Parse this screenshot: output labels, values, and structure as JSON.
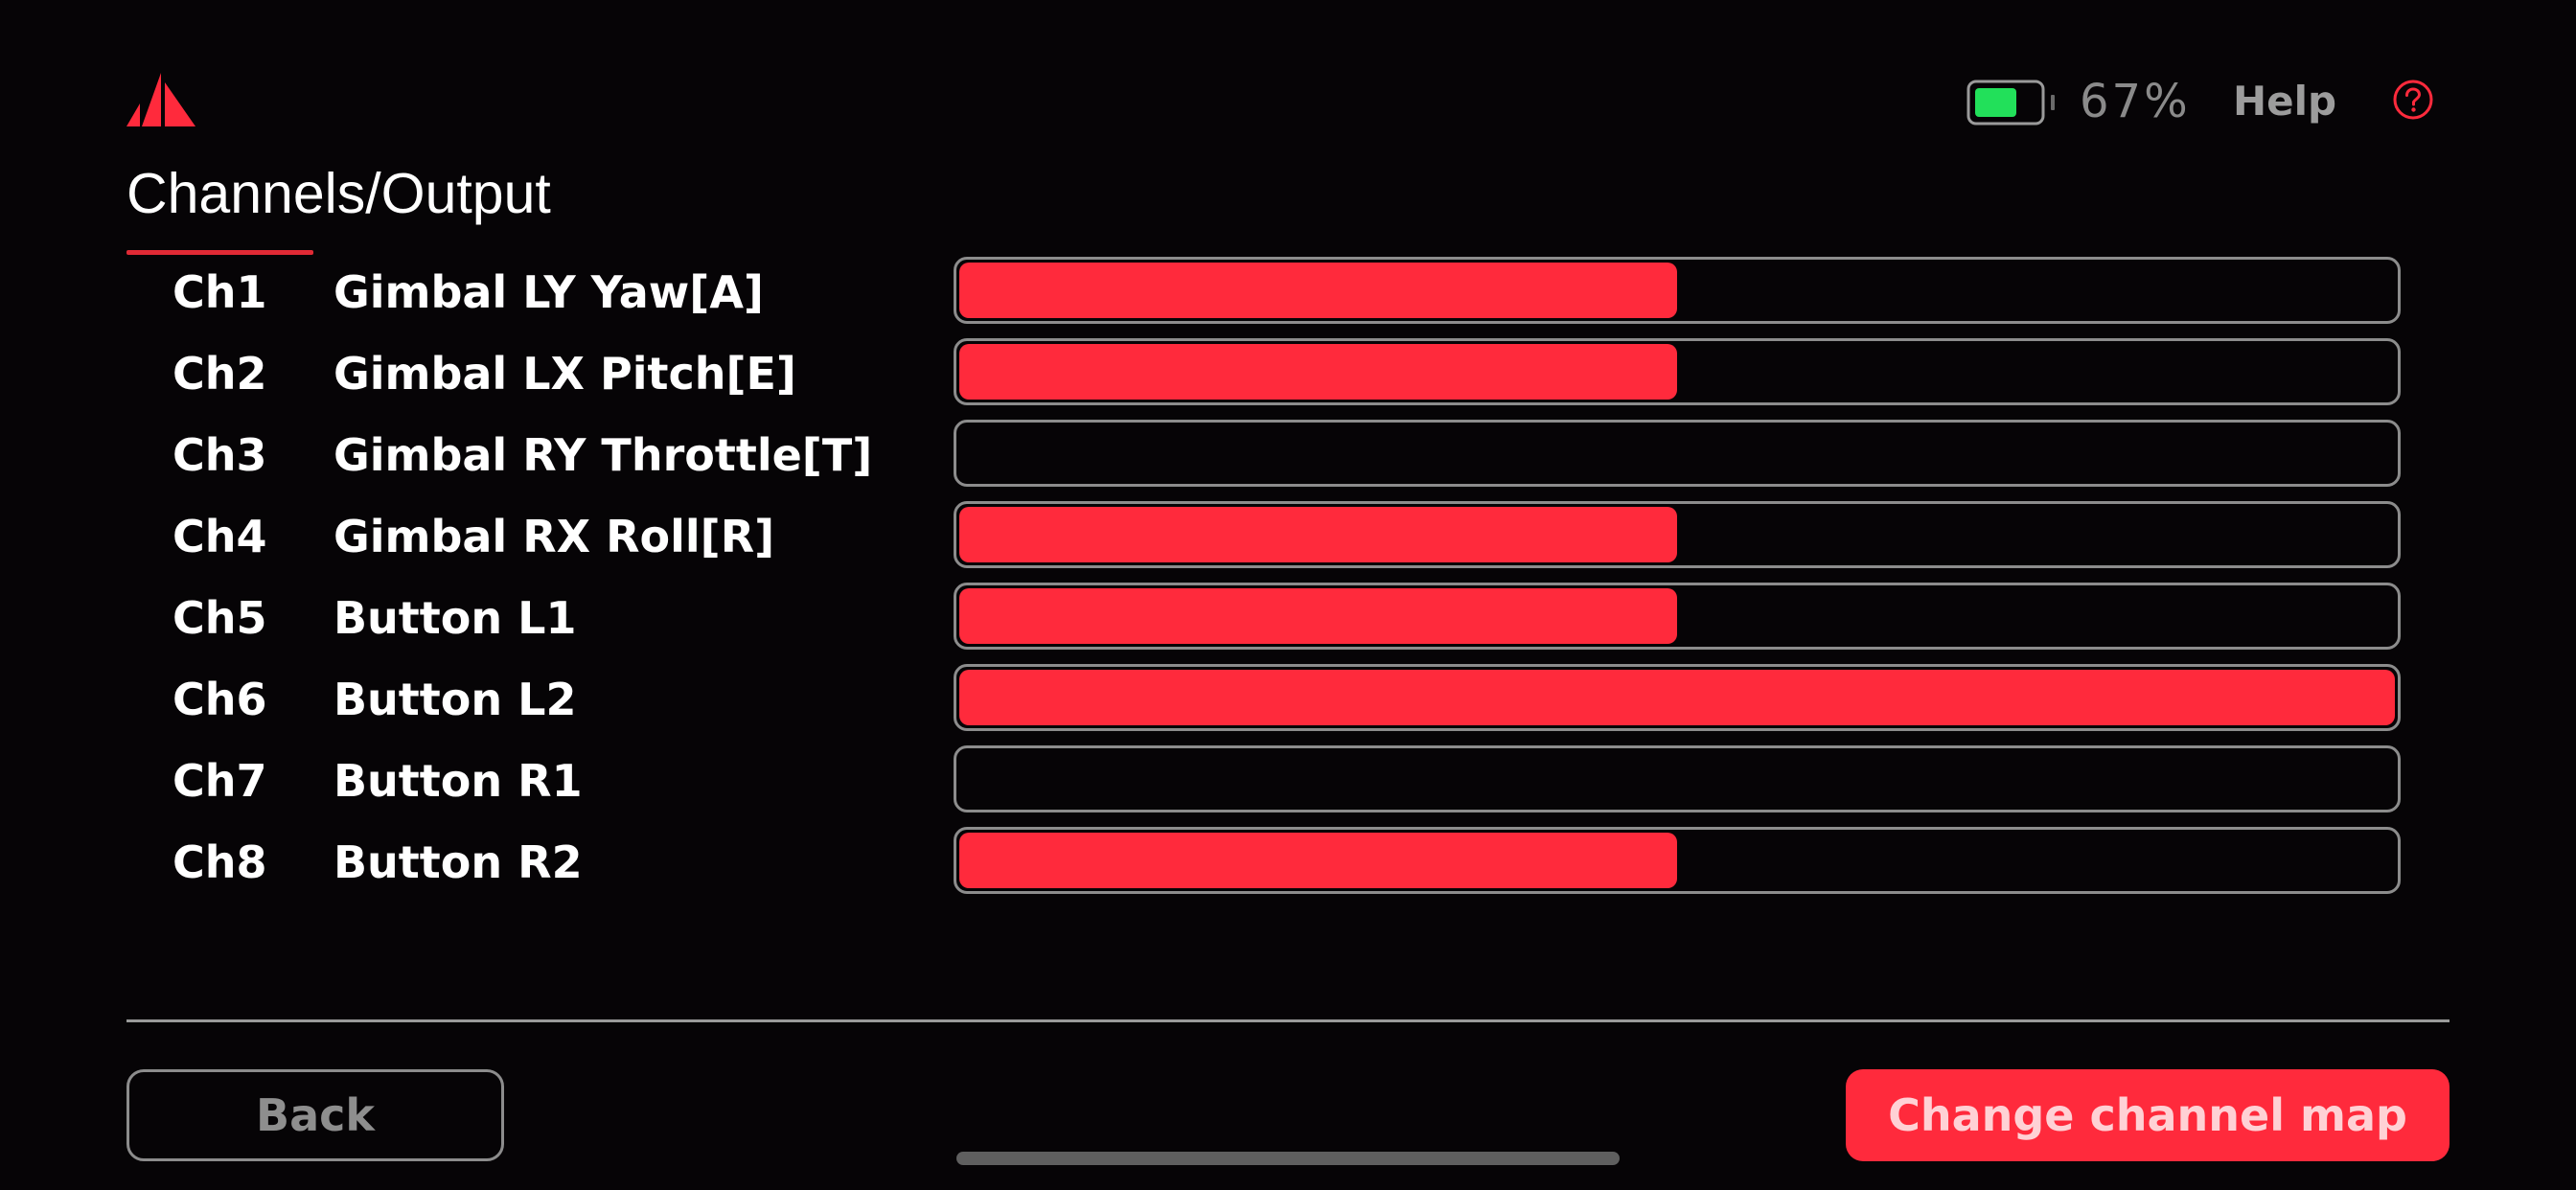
{
  "colors": {
    "accent": "#ff2a3c",
    "battery_fill": "#22e05a",
    "background": "#060406"
  },
  "header": {
    "logo_icon": "app-logo-icon",
    "title": "Channels/Output",
    "battery": {
      "icon": "battery-icon",
      "level": 0.67,
      "label": "67%"
    },
    "help": {
      "label": "Help",
      "icon": "help-circle-icon"
    }
  },
  "channels": [
    {
      "id": "Ch1",
      "name": "Gimbal LY Yaw[A]",
      "level": 0.5
    },
    {
      "id": "Ch2",
      "name": "Gimbal LX Pitch[E]",
      "level": 0.5
    },
    {
      "id": "Ch3",
      "name": "Gimbal RY Throttle[T]",
      "level": 0.0
    },
    {
      "id": "Ch4",
      "name": "Gimbal RX Roll[R]",
      "level": 0.5
    },
    {
      "id": "Ch5",
      "name": "Button L1",
      "level": 0.5
    },
    {
      "id": "Ch6",
      "name": "Button L2",
      "level": 1.0
    },
    {
      "id": "Ch7",
      "name": "Button R1",
      "level": 0.0
    },
    {
      "id": "Ch8",
      "name": "Button R2",
      "level": 0.5
    }
  ],
  "footer": {
    "back_label": "Back",
    "change_map_label": "Change channel map"
  }
}
